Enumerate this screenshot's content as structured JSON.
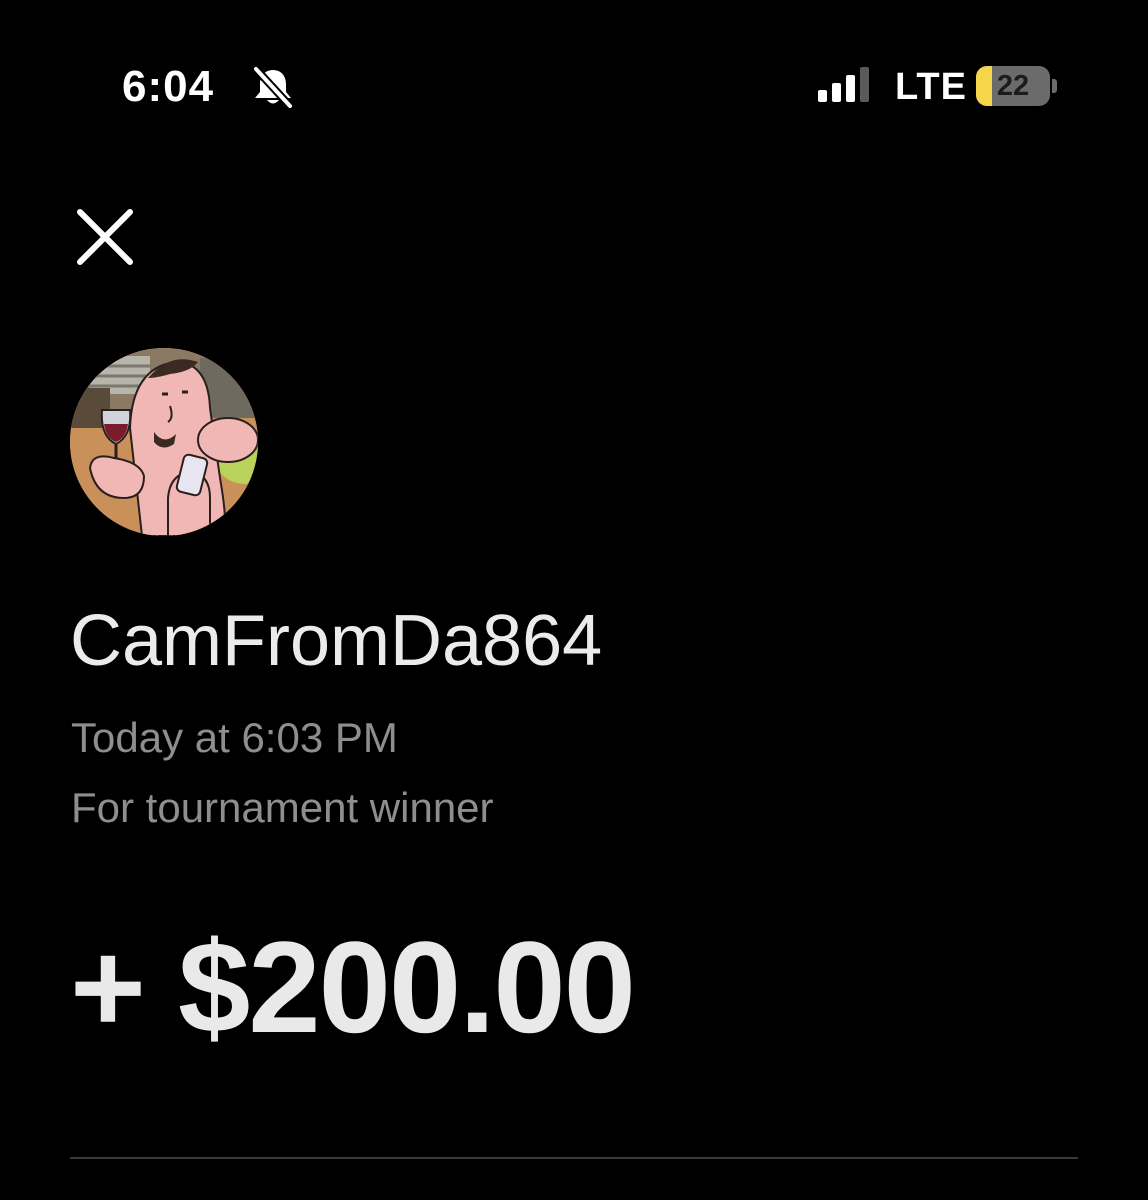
{
  "status_bar": {
    "time": "6:04",
    "network": "LTE",
    "battery_level": "22",
    "battery_fraction": 0.22,
    "icons": [
      "bell-slash-icon",
      "signal-icon",
      "battery-icon"
    ]
  },
  "header": {
    "close_icon": "close-icon"
  },
  "transaction": {
    "user_name": "CamFromDa864",
    "timestamp": "Today at 6:03 PM",
    "note": "For tournament winner",
    "amount": "+ $200.00"
  },
  "colors": {
    "background": "#000000",
    "primary_text": "#e9e9e9",
    "secondary_text": "#8e8e8e",
    "battery_accent": "#f5d64a"
  }
}
